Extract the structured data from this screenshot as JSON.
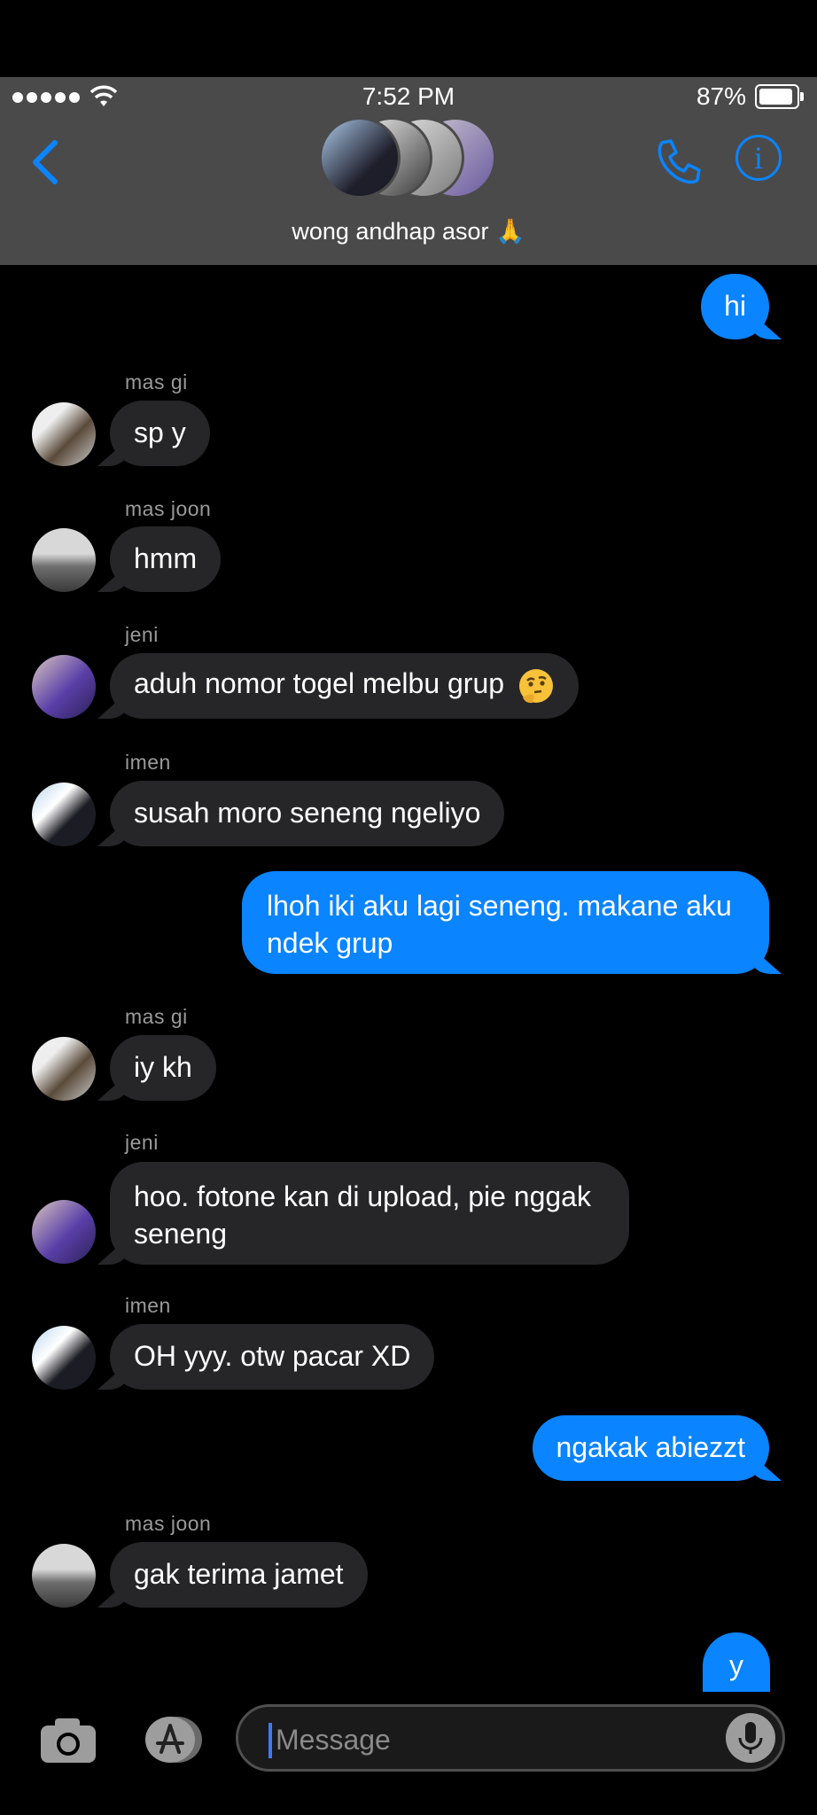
{
  "status_bar": {
    "time": "7:52 PM",
    "battery": "87%"
  },
  "header": {
    "group_name": "wong andhap asor 🙏",
    "back_icon": "chevron-left-icon",
    "call_icon": "phone-icon",
    "info_icon": "info-icon"
  },
  "messages": [
    {
      "direction": "out",
      "text": "hi"
    },
    {
      "direction": "in",
      "sender": "mas gi",
      "text": "sp y"
    },
    {
      "direction": "in",
      "sender": "mas joon",
      "text": "hmm"
    },
    {
      "direction": "in",
      "sender": "jeni",
      "text": "aduh nomor togel melbu grup",
      "emoji": "thinking-face"
    },
    {
      "direction": "in",
      "sender": "imen",
      "text": "susah moro seneng ngeliyo"
    },
    {
      "direction": "out",
      "text": "lhoh iki aku lagi seneng. makane aku ndek grup"
    },
    {
      "direction": "in",
      "sender": "mas gi",
      "text": "iy kh"
    },
    {
      "direction": "in",
      "sender": "jeni",
      "text": "hoo. fotone kan di upload, pie nggak seneng"
    },
    {
      "direction": "in",
      "sender": "imen",
      "text": "OH yyy. otw pacar XD"
    },
    {
      "direction": "out",
      "text": "ngakak abiezzt"
    },
    {
      "direction": "in",
      "sender": "mas joon",
      "text": "gak terima jamet"
    },
    {
      "direction": "out",
      "text": "y"
    }
  ],
  "composer": {
    "placeholder": "Message",
    "camera_icon": "camera-icon",
    "apps_icon": "app-store-icon",
    "mic_icon": "microphone-icon"
  },
  "colors": {
    "accent": "#0a84ff",
    "incoming_bubble": "#262628",
    "header_bg": "#4a4a4a"
  }
}
